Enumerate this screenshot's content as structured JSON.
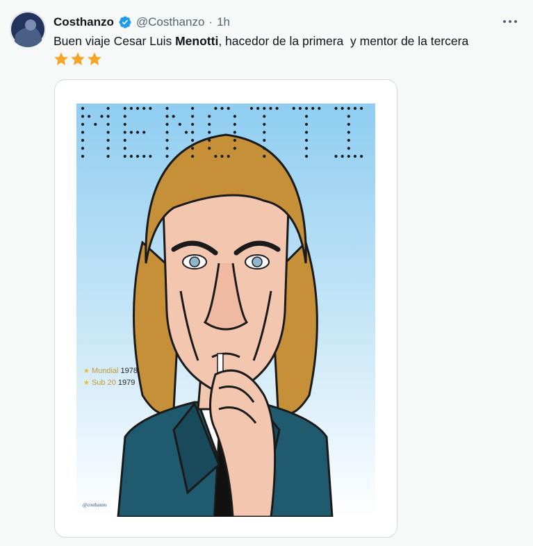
{
  "tweet": {
    "author_name": "Costhanzo",
    "handle": "@Costhanzo",
    "separator": "·",
    "time": "1h",
    "more_label": "···",
    "text_before": "Buen viaje Cesar Luis ",
    "text_bold": "Menotti",
    "text_after": ", hacedor de la primera  y mentor de la tercera",
    "stars_count": 3
  },
  "poster": {
    "title": "MENOTTI",
    "titles": [
      {
        "competition": "Mundial",
        "year": "1978"
      },
      {
        "competition": "Sub 20",
        "year": "1979"
      }
    ],
    "signature": "@costhanzo"
  },
  "colors": {
    "star": "#f4a62a",
    "verified": "#1d9bf0",
    "sky_top": "#8fcdf1",
    "sky_bottom": "#ffffff",
    "hair": "#c69038",
    "skin": "#f3c6b0",
    "jacket": "#1f5a6e"
  },
  "icons": {
    "verified": "verified-badge-icon",
    "more": "more-options-icon",
    "star": "star-icon"
  }
}
